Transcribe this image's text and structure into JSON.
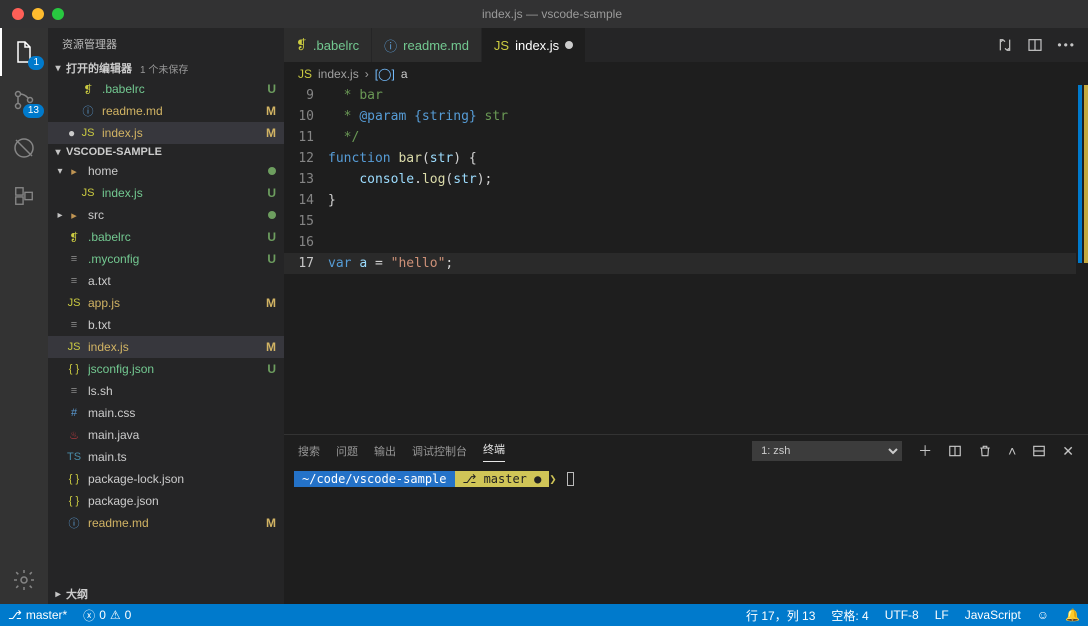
{
  "window": {
    "title": "index.js — vscode-sample"
  },
  "explorer": {
    "title": "资源管理器",
    "openEditors": {
      "label": "打开的编辑器",
      "meta": "1 个未保存"
    },
    "workspaceName": "VSCODE-SAMPLE",
    "outline": "大纲"
  },
  "openEditors": [
    {
      "name": ".babelrc",
      "icon": "babel",
      "status": "U",
      "statusClass": "gituntracked"
    },
    {
      "name": "readme.md",
      "icon": "md",
      "status": "M",
      "statusClass": "gitmod",
      "iconGlyph": "ⓘ"
    },
    {
      "name": "index.js",
      "icon": "js",
      "status": "M",
      "statusClass": "gitmod",
      "selected": true,
      "unsaved": true
    }
  ],
  "tree": [
    {
      "name": "home",
      "kind": "folder",
      "expanded": true,
      "depth": 0,
      "dot": true,
      "children": [
        {
          "name": "index.js",
          "icon": "js",
          "depth": 1,
          "status": "U",
          "statusClass": "gituntracked"
        }
      ]
    },
    {
      "name": "src",
      "kind": "folder",
      "expanded": false,
      "depth": 0,
      "dot": true
    },
    {
      "name": ".babelrc",
      "icon": "babel",
      "depth": 0,
      "status": "U",
      "statusClass": "gituntracked"
    },
    {
      "name": ".myconfig",
      "icon": "txt",
      "depth": 0,
      "status": "U",
      "statusClass": "gituntracked"
    },
    {
      "name": "a.txt",
      "icon": "txt",
      "depth": 0
    },
    {
      "name": "app.js",
      "icon": "js",
      "depth": 0,
      "status": "M",
      "statusClass": "gitmod"
    },
    {
      "name": "b.txt",
      "icon": "txt",
      "depth": 0
    },
    {
      "name": "index.js",
      "icon": "js",
      "depth": 0,
      "status": "M",
      "statusClass": "gitmod",
      "selected": true
    },
    {
      "name": "jsconfig.json",
      "icon": "json",
      "depth": 0,
      "status": "U",
      "statusClass": "gituntracked"
    },
    {
      "name": "ls.sh",
      "icon": "txt",
      "depth": 0
    },
    {
      "name": "main.css",
      "icon": "css",
      "depth": 0
    },
    {
      "name": "main.java",
      "icon": "java",
      "depth": 0
    },
    {
      "name": "main.ts",
      "icon": "ts",
      "depth": 0
    },
    {
      "name": "package-lock.json",
      "icon": "json",
      "depth": 0
    },
    {
      "name": "package.json",
      "icon": "json",
      "depth": 0
    },
    {
      "name": "readme.md",
      "icon": "md",
      "depth": 0,
      "status": "M",
      "statusClass": "gitmod",
      "iconGlyph": "ⓘ"
    }
  ],
  "activityBadges": {
    "explorer": "1",
    "scm": "13"
  },
  "tabs": [
    {
      "label": ".babelrc",
      "icon": "babel"
    },
    {
      "label": "readme.md",
      "icon": "md",
      "iconGlyph": "ⓘ"
    },
    {
      "label": "index.js",
      "icon": "js",
      "active": true,
      "dirty": true
    }
  ],
  "breadcrumbs": {
    "file": "index.js",
    "symbol": "a",
    "symbolKind": "var"
  },
  "code": {
    "firstLine": 9,
    "cursorLine": 17,
    "lines": [
      {
        "n": 9,
        "segs": [
          {
            "t": "  * ",
            "c": "doc"
          },
          {
            "t": "bar",
            "c": "doc"
          }
        ]
      },
      {
        "n": 10,
        "segs": [
          {
            "t": "  * ",
            "c": "doc"
          },
          {
            "t": "@param",
            "c": "tag"
          },
          {
            "t": " ",
            "c": "doc"
          },
          {
            "t": "{string}",
            "c": "tag"
          },
          {
            "t": " str",
            "c": "doc"
          }
        ]
      },
      {
        "n": 11,
        "segs": [
          {
            "t": "  */",
            "c": "doc"
          }
        ]
      },
      {
        "n": 12,
        "segs": [
          {
            "t": "function",
            "c": "kw"
          },
          {
            "t": " ",
            "c": "pln"
          },
          {
            "t": "bar",
            "c": "fn"
          },
          {
            "t": "(",
            "c": "pln"
          },
          {
            "t": "str",
            "c": "var"
          },
          {
            "t": ") {",
            "c": "pln"
          }
        ]
      },
      {
        "n": 13,
        "segs": [
          {
            "t": "    ",
            "c": "pln"
          },
          {
            "t": "console",
            "c": "var"
          },
          {
            "t": ".",
            "c": "pln"
          },
          {
            "t": "log",
            "c": "fn"
          },
          {
            "t": "(",
            "c": "pln"
          },
          {
            "t": "str",
            "c": "var"
          },
          {
            "t": ");",
            "c": "pln"
          }
        ]
      },
      {
        "n": 14,
        "segs": [
          {
            "t": "}",
            "c": "pln"
          }
        ]
      },
      {
        "n": 15,
        "segs": [
          {
            "t": "",
            "c": "pln"
          }
        ]
      },
      {
        "n": 16,
        "segs": [
          {
            "t": "",
            "c": "pln"
          }
        ]
      },
      {
        "n": 17,
        "segs": [
          {
            "t": "var",
            "c": "kw"
          },
          {
            "t": " ",
            "c": "pln"
          },
          {
            "t": "a",
            "c": "var"
          },
          {
            "t": " = ",
            "c": "pln"
          },
          {
            "t": "\"hello\"",
            "c": "str"
          },
          {
            "t": ";",
            "c": "pln"
          }
        ]
      }
    ]
  },
  "panel": {
    "tabs": {
      "search": "搜索",
      "problems": "问题",
      "output": "输出",
      "debug": "调试控制台",
      "terminal": "终端"
    },
    "activeTab": "terminal",
    "terminalSelector": "1: zsh",
    "prompt": {
      "path": "~/code/vscode-sample",
      "branch": "master",
      "dirty": "●"
    }
  },
  "status": {
    "branch": "master*",
    "errors": "0",
    "warnings": "0",
    "position": "行 17，列 13",
    "spaces": "空格: 4",
    "encoding": "UTF-8",
    "eol": "LF",
    "lang": "JavaScript"
  }
}
